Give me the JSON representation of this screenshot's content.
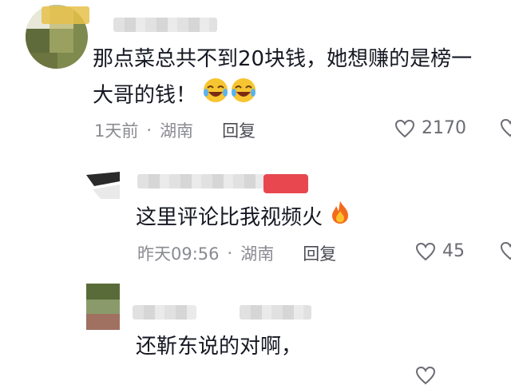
{
  "comments": [
    {
      "text_line1": "那点菜总共不到20块钱，她想赚的是榜一",
      "text_line2": "大哥的钱！",
      "emoji": "😂😂",
      "time": "1天前",
      "location": "湖南",
      "reply_label": "回复",
      "likes": "2170"
    },
    {
      "text": "这里评论比我视频火",
      "emoji": "🔥",
      "time": "昨天09:56",
      "location": "湖南",
      "reply_label": "回复",
      "likes": "45"
    },
    {
      "text": "还靳东说的对啊，"
    }
  ],
  "dot_separator": "·",
  "colors": {
    "text": "#161823",
    "meta": "#8a8b91",
    "reply": "#4a4b52",
    "heart": "#6b6c73",
    "red_tag": "#e8474f"
  }
}
